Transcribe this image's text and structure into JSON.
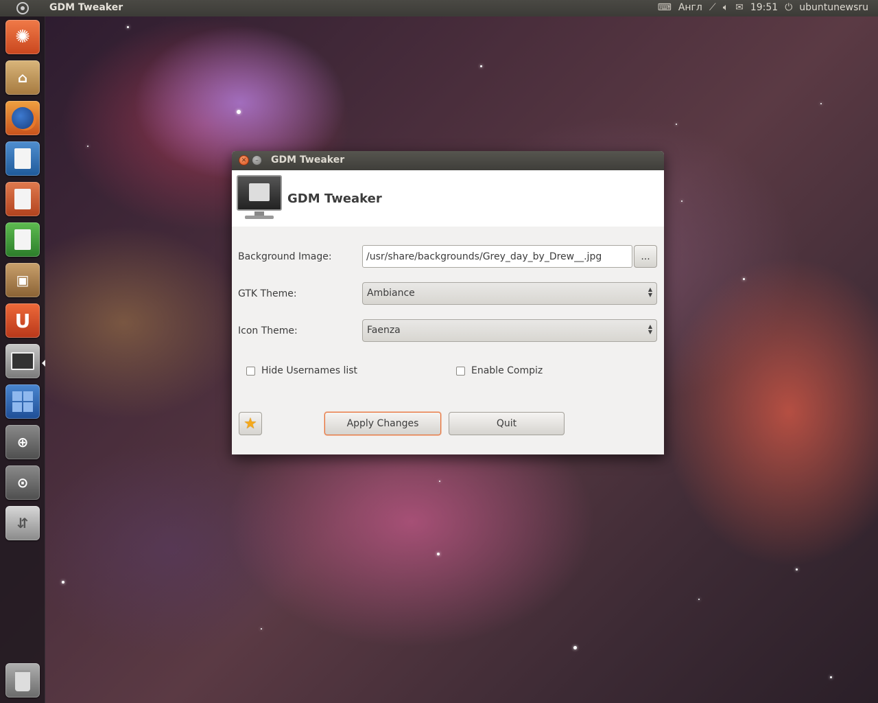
{
  "top_panel": {
    "app_title": "GDM Tweaker",
    "keyboard_layout": "Англ",
    "time": "19:51",
    "username": "ubuntunewsru",
    "icons": [
      "ubuntu-logo-icon",
      "keyboard-icon",
      "network-icon",
      "volume-icon",
      "mail-icon",
      "session-icon"
    ]
  },
  "launcher": {
    "items": [
      {
        "name": "dash-home",
        "icon": "ubuntu-logo-icon",
        "color": "#e05a2a"
      },
      {
        "name": "home-folder",
        "icon": "folder-icon",
        "color": "#c49a5a"
      },
      {
        "name": "firefox",
        "icon": "firefox-icon",
        "color": "#d8782a"
      },
      {
        "name": "libreoffice-writer",
        "icon": "writer-icon",
        "color": "#2f6fb0"
      },
      {
        "name": "libreoffice-impress",
        "icon": "impress-icon",
        "color": "#c9502a"
      },
      {
        "name": "libreoffice-calc",
        "icon": "calc-icon",
        "color": "#3f9a3a"
      },
      {
        "name": "software-center",
        "icon": "software-center-icon",
        "color": "#a87a48"
      },
      {
        "name": "ubuntu-one",
        "icon": "ubuntu-one-icon",
        "color": "#d24a1c"
      },
      {
        "name": "gdm-tweaker",
        "icon": "monitor-icon",
        "color": "#8c8c8c"
      },
      {
        "name": "workspace-switcher",
        "icon": "workspaces-icon",
        "color": "#2a5ea8"
      },
      {
        "name": "zoom-in",
        "icon": "zoom-in-icon",
        "color": "#6e6e6e"
      },
      {
        "name": "zoom-search",
        "icon": "zoom-search-icon",
        "color": "#6e6e6e"
      },
      {
        "name": "usb-drive",
        "icon": "usb-icon",
        "color": "#9a9a9a"
      },
      {
        "name": "trash",
        "icon": "trash-icon",
        "color": "#8a8a8a"
      }
    ]
  },
  "window": {
    "title": "GDM Tweaker",
    "banner_heading": "GDM Tweaker",
    "fields": {
      "background_label": "Background Image:",
      "background_value": "/usr/share/backgrounds/Grey_day_by_Drew__.jpg",
      "browse_label": "...",
      "gtk_label": "GTK Theme:",
      "gtk_value": "Ambiance",
      "icon_label": "Icon Theme:",
      "icon_value": "Faenza"
    },
    "checkboxes": {
      "hide_usernames": "Hide Usernames list",
      "enable_compiz": "Enable Compiz"
    },
    "buttons": {
      "apply": "Apply Changes",
      "quit": "Quit"
    },
    "accent_color": "#e86f35"
  }
}
